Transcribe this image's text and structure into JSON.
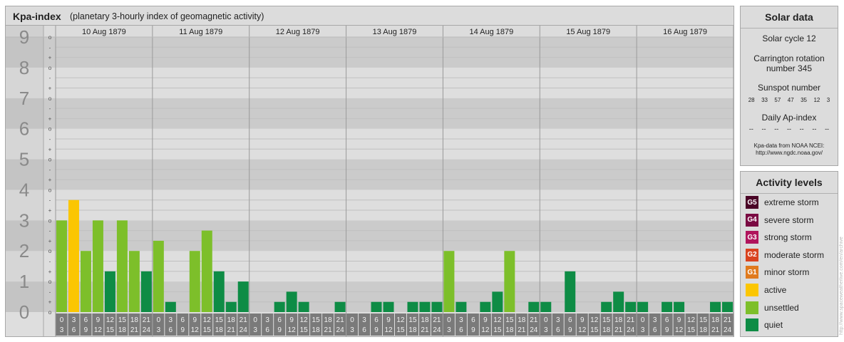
{
  "header": {
    "title": "Kpa-index",
    "subtitle": "(planetary 3-hourly index of geomagnetic activity)"
  },
  "colors": {
    "quiet": "#0e8c45",
    "unsettled": "#7dbf2a",
    "active": "#fbc602",
    "minor_storm": "#e07a1e",
    "moderate_storm": "#d9431f",
    "strong_storm": "#b0145c",
    "severe_storm": "#7a0a42",
    "extreme_storm": "#4a0326"
  },
  "chart_data": {
    "type": "bar",
    "title": "Kpa-index",
    "subtitle": "(planetary 3-hourly index of geomagnetic activity)",
    "y_ticks": [
      "0",
      "1",
      "2",
      "3",
      "4",
      "5",
      "6",
      "7",
      "8",
      "9"
    ],
    "y_minor_labels": [
      "o",
      "+",
      "-",
      "o",
      "+",
      "-",
      "o",
      "+",
      "-",
      "o",
      "+",
      "-",
      "o",
      "+",
      "-",
      "o",
      "+",
      "-",
      "o",
      "+",
      "-",
      "o",
      "+",
      "-",
      "o",
      "+",
      "-",
      "o"
    ],
    "ylim": [
      0,
      9
    ],
    "days": [
      "10 Aug 1879",
      "11 Aug 1879",
      "12 Aug 1879",
      "13 Aug 1879",
      "14 Aug 1879",
      "15 Aug 1879",
      "16 Aug 1879"
    ],
    "interval_start": [
      "0",
      "3",
      "6",
      "9",
      "12",
      "15",
      "18",
      "21"
    ],
    "interval_end": [
      "3",
      "6",
      "9",
      "12",
      "15",
      "18",
      "21",
      "24"
    ],
    "series": [
      {
        "values": [
          3.0,
          3.667,
          2.0,
          3.0,
          1.333,
          3.0,
          2.0,
          1.333,
          2.333,
          0.333,
          0.0,
          2.0,
          2.667,
          1.333,
          0.333,
          1.0,
          0.0,
          0.0,
          0.333,
          0.667,
          0.333,
          0.0,
          0.0,
          0.333,
          0.0,
          0.0,
          0.333,
          0.333,
          0.0,
          0.333,
          0.333,
          0.333,
          2.0,
          0.333,
          0.0,
          0.333,
          0.667,
          2.0,
          0.0,
          0.333,
          0.333,
          0.0,
          1.333,
          0.0,
          0.0,
          0.333,
          0.667,
          0.333,
          0.333,
          0.0,
          0.333,
          0.333,
          0.0,
          0.0,
          0.333,
          0.333
        ],
        "levels": [
          "unsettled",
          "active",
          "unsettled",
          "unsettled",
          "quiet",
          "unsettled",
          "unsettled",
          "quiet",
          "unsettled",
          "quiet",
          "quiet",
          "unsettled",
          "unsettled",
          "quiet",
          "quiet",
          "quiet",
          "quiet",
          "quiet",
          "quiet",
          "quiet",
          "quiet",
          "quiet",
          "quiet",
          "quiet",
          "quiet",
          "quiet",
          "quiet",
          "quiet",
          "quiet",
          "quiet",
          "quiet",
          "quiet",
          "unsettled",
          "quiet",
          "quiet",
          "quiet",
          "quiet",
          "unsettled",
          "quiet",
          "quiet",
          "quiet",
          "quiet",
          "quiet",
          "quiet",
          "quiet",
          "quiet",
          "quiet",
          "quiet",
          "quiet",
          "quiet",
          "quiet",
          "quiet",
          "quiet",
          "quiet",
          "quiet",
          "quiet"
        ]
      }
    ]
  },
  "solar": {
    "title": "Solar data",
    "cycle": "Solar cycle 12",
    "carrington_line1": "Carrington rotation",
    "carrington_line2": "number 345",
    "sunspot_label": "Sunspot number",
    "sunspot_values": [
      "28",
      "33",
      "57",
      "47",
      "35",
      "12",
      "3"
    ],
    "ap_label": "Daily Ap-index",
    "ap_values": [
      "--",
      "--",
      "--",
      "--",
      "--",
      "--",
      "--"
    ],
    "source_line1": "Kpa-data from NOAA NCEI:",
    "source_line2": "http://www.ngdc.noaa.gov/"
  },
  "activity": {
    "title": "Activity levels",
    "items": [
      {
        "badge": "G5",
        "label": "extreme storm",
        "color": "#4a0326"
      },
      {
        "badge": "G4",
        "label": "severe storm",
        "color": "#7a0a42"
      },
      {
        "badge": "G3",
        "label": "strong storm",
        "color": "#b0145c"
      },
      {
        "badge": "G2",
        "label": "moderate storm",
        "color": "#d9431f"
      },
      {
        "badge": "G1",
        "label": "minor storm",
        "color": "#e07a1e"
      },
      {
        "badge": "",
        "label": "active",
        "color": "#fbc602"
      },
      {
        "badge": "",
        "label": "unsettled",
        "color": "#7dbf2a"
      },
      {
        "badge": "",
        "label": "quiet",
        "color": "#0e8c45"
      }
    ]
  },
  "watermark": "http://www.spaceweatherlive.com/en/archive"
}
